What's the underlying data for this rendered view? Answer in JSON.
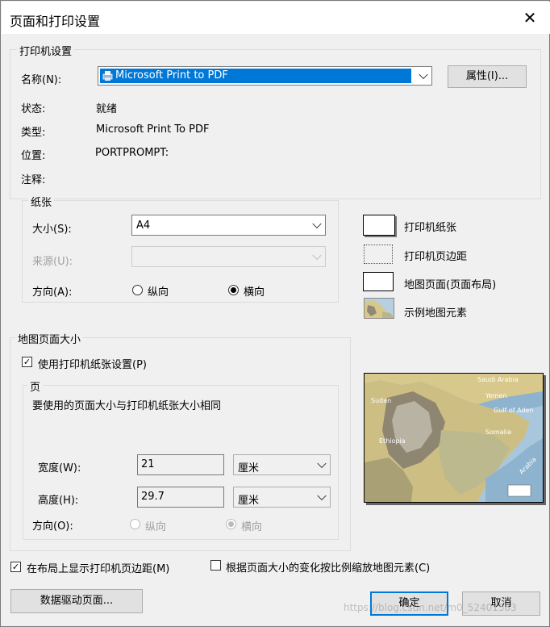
{
  "window": {
    "title": "页面和打印设置",
    "close": "✕"
  },
  "printer": {
    "group_title": "打印机设置",
    "name_label": "名称(N):",
    "name_value": "Microsoft Print to PDF",
    "properties_button": "属性(I)...",
    "status_label": "状态:",
    "status_value": "就绪",
    "type_label": "类型:",
    "type_value": "Microsoft Print To PDF",
    "location_label": "位置:",
    "location_value": "PORTPROMPT:",
    "comment_label": "注释:"
  },
  "paper": {
    "group_title": "纸张",
    "size_label": "大小(S):",
    "size_value": "A4",
    "source_label": "来源(U):",
    "orientation_label": "方向(A):",
    "portrait": "纵向",
    "landscape": "横向"
  },
  "legend": {
    "printer_paper": "打印机纸张",
    "printer_margins": "打印机页边距",
    "map_page": "地图页面(页面布局)",
    "sample_elements": "示例地图元素"
  },
  "map_page_size": {
    "group_title": "地图页面大小",
    "use_printer_paper": "使用打印机纸张设置(P)",
    "page_group_title": "页",
    "page_note": "要使用的页面大小与打印机纸张大小相同",
    "width_label": "宽度(W):",
    "width_value": "21",
    "width_unit": "厘米",
    "height_label": "高度(H):",
    "height_value": "29.7",
    "height_unit": "厘米",
    "orientation_label": "方向(O):",
    "portrait": "纵向",
    "landscape": "横向"
  },
  "preview_map": {
    "labels": [
      "Saudi Arabia",
      "Sudan",
      "Yemen",
      "Gulf of Aden",
      "Ethiopia",
      "Somalia",
      "Arabia"
    ]
  },
  "bottom": {
    "show_margins": "在布局上显示打印机页边距(M)",
    "scale_elements": "根据页面大小的变化按比例缩放地图元素(C)",
    "data_driven_pages": "数据驱动页面...",
    "ok": "确定",
    "cancel": "取消",
    "watermark": "https://blog.csdn.net/m0_52401583"
  }
}
